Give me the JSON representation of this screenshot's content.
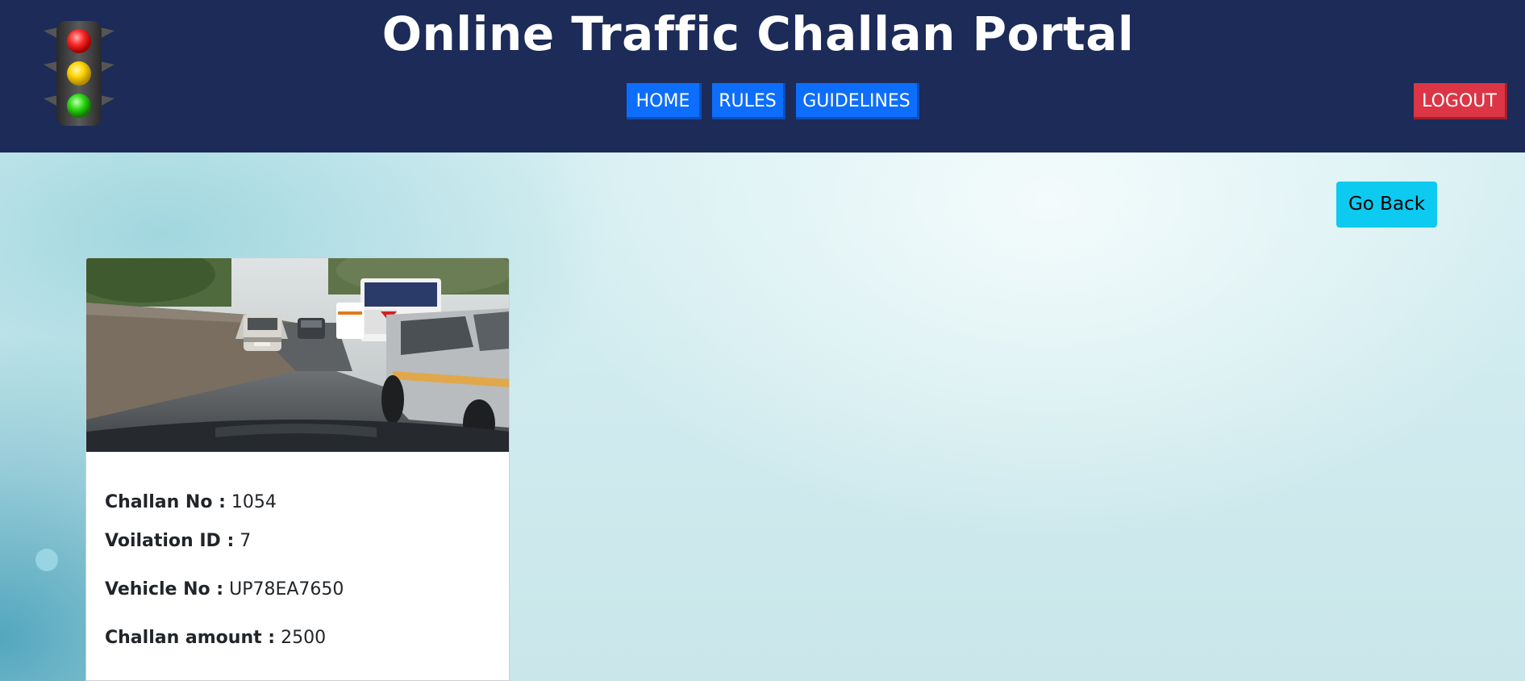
{
  "header": {
    "title": "Online Traffic Challan Portal",
    "logo_icon": "traffic-light-icon",
    "nav": [
      {
        "label": "HOME"
      },
      {
        "label": "RULES"
      },
      {
        "label": "GUIDELINES"
      }
    ],
    "logout_label": "LOGOUT"
  },
  "main": {
    "go_back_label": "Go Back",
    "card": {
      "image": "traffic-road-photo",
      "fields": [
        {
          "label": "Challan No :",
          "value": "1054"
        },
        {
          "label": "Voilation ID :",
          "value": "7"
        },
        {
          "label": "Vehicle No :",
          "value": "UP78EA7650"
        },
        {
          "label": "Challan amount :",
          "value": "2500"
        }
      ]
    }
  },
  "colors": {
    "header_bg": "#1c2b58",
    "nav_button": "#0d6efd",
    "logout_button": "#dc3545",
    "go_back_button": "#0dcaf0"
  }
}
